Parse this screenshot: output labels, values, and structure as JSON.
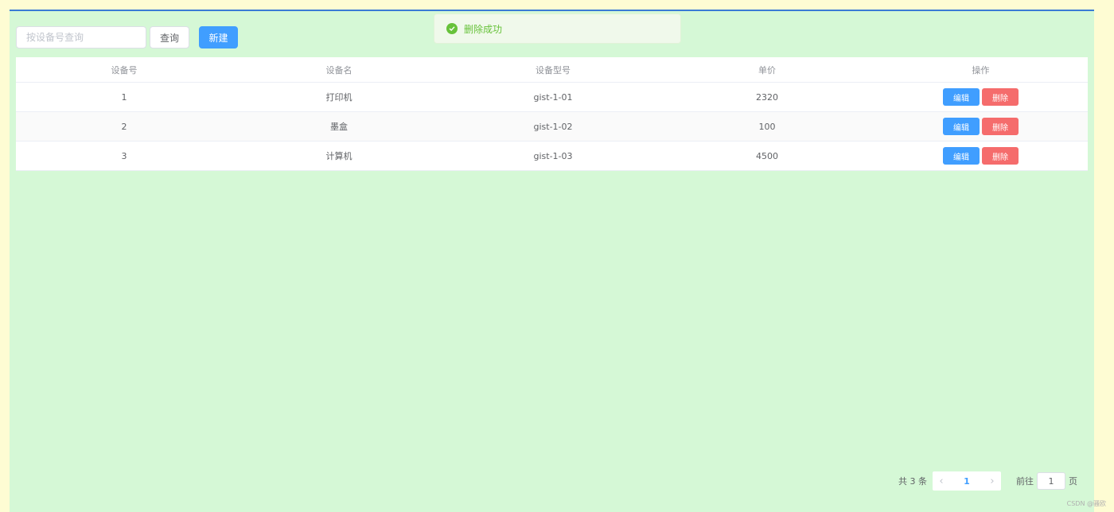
{
  "toolbar": {
    "search_placeholder": "按设备号查询",
    "query_label": "查询",
    "new_label": "新建"
  },
  "toast": {
    "message": "删除成功",
    "icon": "check-circle-icon",
    "color": "#67c23a"
  },
  "table": {
    "headers": [
      "设备号",
      "设备名",
      "设备型号",
      "单价",
      "操作"
    ],
    "rows": [
      {
        "id": "1",
        "name": "打印机",
        "model": "gist-1-01",
        "price": "2320"
      },
      {
        "id": "2",
        "name": "墨盒",
        "model": "gist-1-02",
        "price": "100"
      },
      {
        "id": "3",
        "name": "计算机",
        "model": "gist-1-03",
        "price": "4500"
      }
    ],
    "edit_label": "编辑",
    "delete_label": "删除"
  },
  "pagination": {
    "total_text": "共 3 条",
    "current_page": "1",
    "goto_label": "前往",
    "jump_value": "1",
    "page_suffix": "页",
    "prev_icon": "chevron-left-icon",
    "next_icon": "chevron-right-icon"
  },
  "watermark": "CSDN @骚欧",
  "colors": {
    "primary": "#409eff",
    "danger": "#f56c6c",
    "success": "#67c23a",
    "panel_bg": "#d5f8d6",
    "page_bg": "#fefcd3"
  }
}
